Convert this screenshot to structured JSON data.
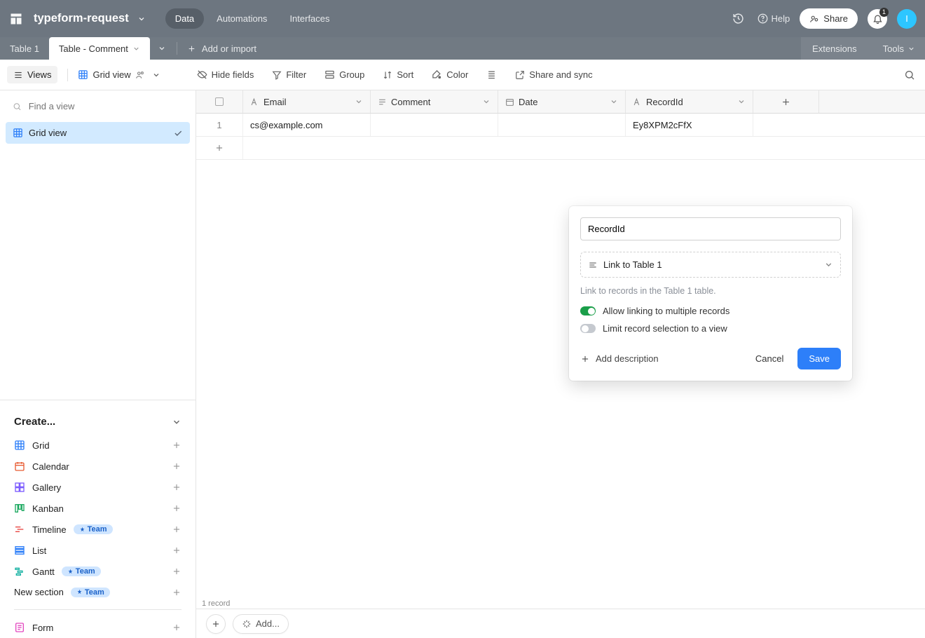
{
  "app": {
    "base_name": "typeform-request",
    "tabs": {
      "data": "Data",
      "automations": "Automations",
      "interfaces": "Interfaces"
    },
    "help": "Help",
    "share": "Share",
    "notification_count": "1",
    "avatar_initial": "I"
  },
  "tablebar": {
    "tab1": "Table 1",
    "tab2": "Table - Comment",
    "add_import": "Add or import",
    "extensions": "Extensions",
    "tools": "Tools"
  },
  "viewbar": {
    "views": "Views",
    "gridview": "Grid view",
    "hide_fields": "Hide fields",
    "filter": "Filter",
    "group": "Group",
    "sort": "Sort",
    "color": "Color",
    "share_sync": "Share and sync"
  },
  "sidebar": {
    "find_placeholder": "Find a view",
    "gridview": "Grid view",
    "create": "Create...",
    "types": {
      "grid": "Grid",
      "calendar": "Calendar",
      "gallery": "Gallery",
      "kanban": "Kanban",
      "timeline": "Timeline",
      "list": "List",
      "gantt": "Gantt",
      "new_section": "New section",
      "form": "Form"
    },
    "team": "Team"
  },
  "grid": {
    "cols": {
      "email": "Email",
      "comment": "Comment",
      "date": "Date",
      "recordid": "RecordId"
    },
    "rows": [
      {
        "n": "1",
        "email": "cs@example.com",
        "comment": "",
        "date": "",
        "recordid": "Ey8XPM2cFfX"
      }
    ],
    "record_count": "1 record",
    "add_btn": "Add..."
  },
  "popover": {
    "name_value": "RecordId",
    "type_label": "Link to Table 1",
    "helper": "Link to records in the Table 1 table.",
    "allow_multi": "Allow linking to multiple records",
    "limit_view": "Limit record selection to a view",
    "add_desc": "Add description",
    "cancel": "Cancel",
    "save": "Save"
  }
}
